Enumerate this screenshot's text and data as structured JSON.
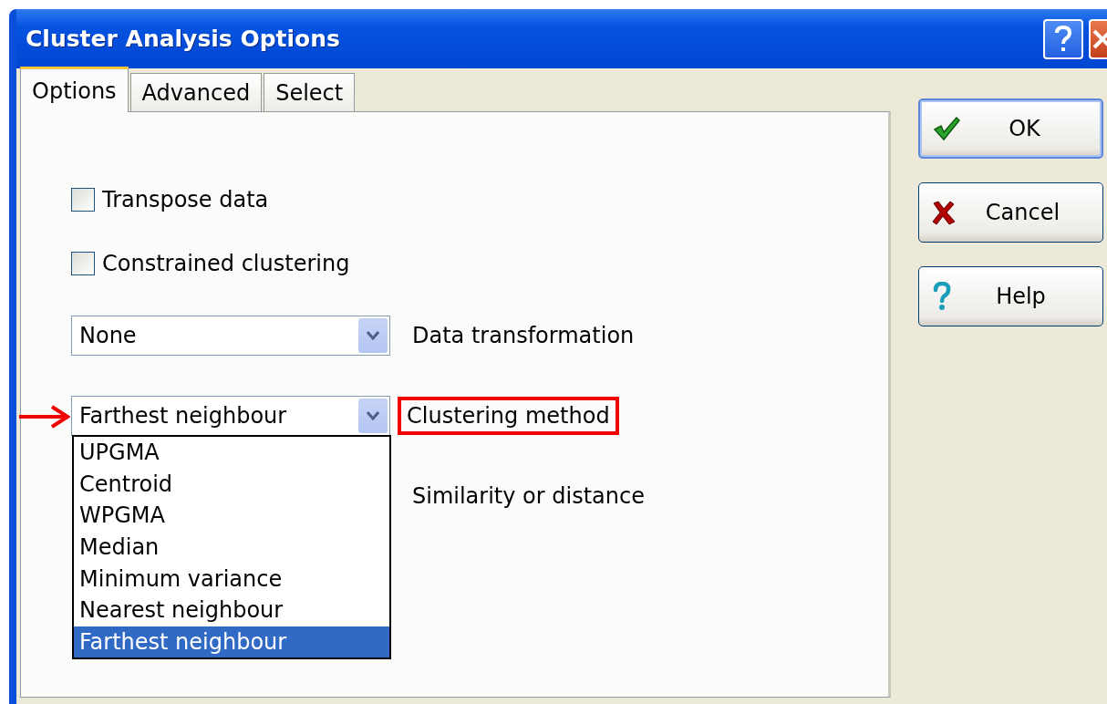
{
  "window": {
    "title": "Cluster Analysis Options"
  },
  "tabs": [
    {
      "label": "Options",
      "selected": true
    },
    {
      "label": "Advanced",
      "selected": false
    },
    {
      "label": "Select",
      "selected": false
    }
  ],
  "checkboxes": [
    {
      "label": "Transpose data",
      "checked": false
    },
    {
      "label": "Constrained clustering",
      "checked": false
    }
  ],
  "settings": [
    {
      "kind": "combo",
      "value": "None",
      "label": "Data transformation",
      "annotated": false
    },
    {
      "kind": "combo",
      "value": "Farthest neighbour",
      "label": "Clustering method",
      "annotated": true,
      "expanded": true,
      "options": [
        {
          "label": "UPGMA",
          "selected": false
        },
        {
          "label": "Centroid",
          "selected": false
        },
        {
          "label": "WPGMA",
          "selected": false
        },
        {
          "label": "Median",
          "selected": false
        },
        {
          "label": "Minimum variance",
          "selected": false
        },
        {
          "label": "Nearest neighbour",
          "selected": false
        },
        {
          "label": "Farthest neighbour",
          "selected": true
        }
      ]
    },
    {
      "kind": "label",
      "label": "Similarity or distance"
    }
  ],
  "buttons": [
    {
      "label": "OK",
      "kind": "ok",
      "default": true
    },
    {
      "label": "Cancel",
      "kind": "cancel",
      "default": false
    },
    {
      "label": "Help",
      "kind": "help",
      "default": false
    }
  ]
}
